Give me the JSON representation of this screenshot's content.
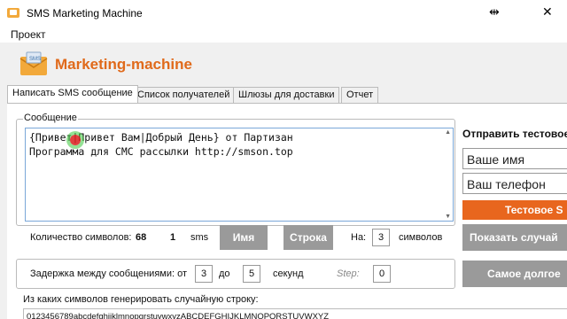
{
  "window": {
    "title": "SMS Marketing Machine",
    "controls": {
      "minimize": "—",
      "restore": "⇹",
      "close": "✕"
    }
  },
  "menu": {
    "items": [
      "Проект"
    ]
  },
  "brand": {
    "name": "Marketing-machine",
    "color": "#e06a1b"
  },
  "tabs": [
    {
      "label": "Написать SMS сообщение",
      "active": true
    },
    {
      "label": "Список получателей",
      "active": false
    },
    {
      "label": "Шлюзы для доставки",
      "active": false
    },
    {
      "label": "Отчет",
      "active": false
    }
  ],
  "message": {
    "group_label": "Сообщение",
    "lines": [
      "{Привет|Привет Вам|Добрый День} от Партизан",
      "Программа для СМС рассылки http://smson.top"
    ]
  },
  "stats": {
    "char_count_label": "Количество символов:",
    "char_count": "68",
    "sms_count": "1",
    "sms_label": "sms",
    "name_button": "Имя",
    "string_button": "Строка",
    "on_label": "На:",
    "symbols_count": "3",
    "symbols_label": "символов"
  },
  "delay": {
    "label": "Задержка между сообщениями: от",
    "from": "3",
    "to_label": "до",
    "to": "5",
    "unit": "секунд",
    "step_label": "Step:",
    "step": "0"
  },
  "right": {
    "title": "Отправить тестовое",
    "name_placeholder": "Ваше имя",
    "phone_placeholder": "Ваш телефон",
    "test_button": "Тестовое S",
    "show_random_button": "Показать случай",
    "longest_button": "Самое долгое"
  },
  "random": {
    "label": "Из каких символов генерировать случайную строку:",
    "value": "0123456789abcdefghijklmnopqrstuvwxyzABCDEFGHIJKLMNOPQRSTUVWXYZ"
  },
  "colors": {
    "accent_orange": "#e8661e",
    "button_gray": "#9a9a9a",
    "focus_blue": "#7aa7d8"
  }
}
